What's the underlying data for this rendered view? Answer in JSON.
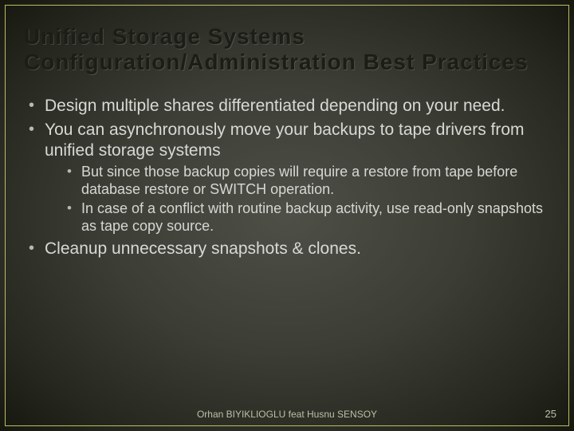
{
  "title": "Unified Storage Systems Configuration/Administration Best Practices",
  "bullets": [
    {
      "text": "Design multiple shares differentiated depending on your need."
    },
    {
      "text": "You can asynchronously move your backups to tape drivers from unified storage systems",
      "sub": [
        "But since those backup copies will require a restore from tape before database restore or SWITCH operation.",
        "In case of a conflict with routine backup activity, use read-only snapshots as  tape  copy source."
      ]
    },
    {
      "text": "Cleanup unnecessary snapshots & clones."
    }
  ],
  "footer": {
    "author": "Orhan BIYIKLIOGLU feat Husnu SENSOY",
    "page": "25"
  }
}
